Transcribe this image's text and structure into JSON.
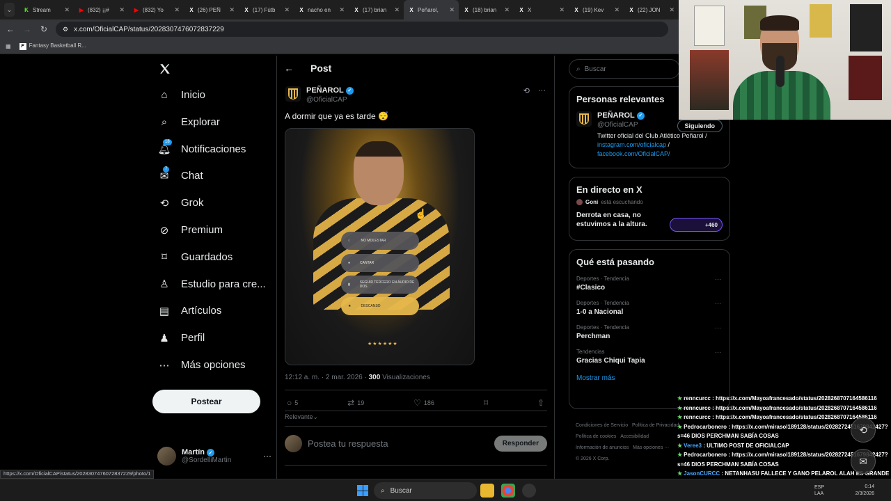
{
  "browser": {
    "tabs": [
      {
        "label": "Stream",
        "fav": "K",
        "color": "#53fc18"
      },
      {
        "label": "(832) ¡¡#",
        "fav": "▶",
        "color": "#ff0000"
      },
      {
        "label": "(832) Yo",
        "fav": "▶",
        "color": "#ff0000"
      },
      {
        "label": "(26) PEÑ",
        "fav": "X",
        "color": "#ffffff"
      },
      {
        "label": "(17) Fútb",
        "fav": "X",
        "color": "#ffffff"
      },
      {
        "label": "nacho en",
        "fav": "X",
        "color": "#ffffff"
      },
      {
        "label": "(17) brian",
        "fav": "X",
        "color": "#ffffff"
      },
      {
        "label": "Peñarol,",
        "fav": "X",
        "color": "#ffffff"
      },
      {
        "label": "(18) brian",
        "fav": "X",
        "color": "#ffffff"
      },
      {
        "label": "X",
        "fav": "X",
        "color": "#ffffff"
      },
      {
        "label": "(19) Kev",
        "fav": "X",
        "color": "#ffffff"
      },
      {
        "label": "(22) JON",
        "fav": "X",
        "color": "#ffffff"
      }
    ],
    "url": "x.com/OficialCAP/status/2028307476072837229",
    "bookmark": "Fantasy Basketball R...",
    "hover_url": "https://x.com/OficialCAP/status/2028307476072837229/photo/1"
  },
  "nav": {
    "items": [
      {
        "label": "Inicio",
        "icon": "home-icon"
      },
      {
        "label": "Explorar",
        "icon": "search-icon"
      },
      {
        "label": "Notificaciones",
        "icon": "bell-icon",
        "badge": "18"
      },
      {
        "label": "Chat",
        "icon": "mail-icon",
        "badge": "7"
      },
      {
        "label": "Grok",
        "icon": "grok-icon"
      },
      {
        "label": "Premium",
        "icon": "premium-icon"
      },
      {
        "label": "Guardados",
        "icon": "bookmark-icon"
      },
      {
        "label": "Estudio para cre...",
        "icon": "studio-icon"
      },
      {
        "label": "Artículos",
        "icon": "articles-icon"
      },
      {
        "label": "Perfil",
        "icon": "person-icon"
      },
      {
        "label": "Más opciones",
        "icon": "more-circle-icon"
      }
    ],
    "post_button": "Postear",
    "account": {
      "name": "Martín",
      "handle": "@SordelliMartin"
    }
  },
  "post": {
    "header": "Post",
    "author_name": "PEÑAROL",
    "author_handle": "@OficialCAP",
    "text": "A dormir que ya es tarde 😴",
    "media_buttons": [
      "NO MOLESTAR",
      "CANTAR",
      "SEGUIR TERCERO EN AUDIO DE DOS",
      "DESCANSO"
    ],
    "media_stars": "★★★★★★",
    "time": "12:12 a. m. · 2 mar. 2026 · ",
    "views_count": "300",
    "views_label": " Visualizaciones",
    "replies": "5",
    "reposts": "19",
    "likes": "186",
    "sort_label": "Relevante",
    "reply_placeholder": "Postea tu respuesta",
    "reply_button": "Responder"
  },
  "right": {
    "search_placeholder": "Buscar",
    "relevant": {
      "title": "Personas relevantes",
      "name": "PEÑAROL",
      "handle": "@OficialCAP",
      "follow_label": "Siguiendo",
      "bio": "Twitter oficial del Club Atlético Peñarol / ",
      "link1": "instagram.com/oficialcap",
      "bio_sep": " / ",
      "link2": "facebook.com/OficialCAP/"
    },
    "live": {
      "title": "En directo en X",
      "host": "Goni",
      "status": " está escuchando",
      "space_title": "Derrota en casa, no estuvimos a la altura.",
      "listeners": "+460"
    },
    "trends": {
      "title": "Qué está pasando",
      "items": [
        {
          "context": "Deportes · Tendencia",
          "name": "#Clasico"
        },
        {
          "context": "Deportes · Tendencia",
          "name": "1-0 a Nacional"
        },
        {
          "context": "Deportes · Tendencia",
          "name": "Perchman"
        },
        {
          "context": "Tendencias",
          "name": "Gracias Chiqui Tapia"
        }
      ],
      "show_more": "Mostrar más"
    },
    "footer": [
      "Condiciones de Servicio",
      "Política de Privacidad",
      "Política de cookies",
      "Accesibilidad",
      "Información de anuncios",
      "Más opciones ···",
      "© 2026 X Corp."
    ]
  },
  "chat": [
    {
      "user": "renncurcc",
      "msg": "https://x.com/Mayoafrancesado/status/2028268707164586116",
      "cls": "chat-user"
    },
    {
      "user": "renncurcc",
      "msg": "https://x.com/Mayoafrancesado/status/2028268707164586116",
      "cls": "chat-user"
    },
    {
      "user": "renncurcc",
      "msg": "https://x.com/Mayoafrancesado/status/2028268707164586116",
      "cls": "chat-user"
    },
    {
      "user": "Pedrocarbonero",
      "msg": "https://x.com/mirasol189128/status/2028272451679842427?s=46 DIOS PERCHMAN SABÍA COSAS",
      "cls": "chat-user"
    },
    {
      "user": "Veree3",
      "msg": "ULTIMO POST DE OFICIALCAP",
      "cls": "u-blue"
    },
    {
      "user": "Pedrocarbonero",
      "msg": "https://x.com/mirasol189128/status/2028272451679842427?s=46 DIOS PERCHMAN SABÍA COSAS",
      "cls": "chat-user"
    },
    {
      "user": "JasonCURCC",
      "msg": "NETANHASU FALLECE Y GANO PELAROL ALAH ES GRANDE",
      "cls": "u-blue"
    }
  ],
  "taskbar": {
    "search": "Buscar",
    "lang": "ESP",
    "lang2": "LAA",
    "time": "0:14",
    "date": "2/3/2026"
  }
}
